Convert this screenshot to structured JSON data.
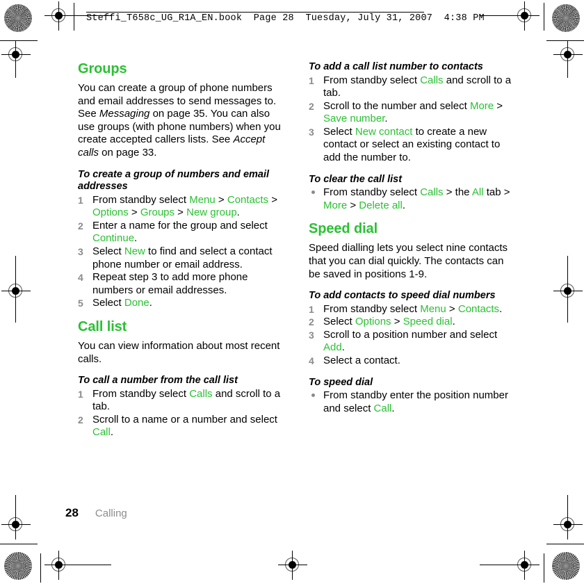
{
  "header": {
    "slug": "Steffi_T658c_UG_R1A_EN.book  Page 28  Tuesday, July 31, 2007  4:38 PM"
  },
  "footer": {
    "page_number": "28",
    "chapter": "Calling"
  },
  "colors": {
    "accent_green": "#2bc034",
    "step_number_gray": "#8a8a8a",
    "chapter_gray": "#8c8c8c",
    "body_black": "#000000"
  },
  "left_column": {
    "section_title": "Groups",
    "intro_a": "You can create a group of phone numbers and email addresses to send messages to. See ",
    "intro_a_em": "Messaging",
    "intro_b": " on page 35. You can also use groups (with phone numbers) when you create accepted callers lists. See ",
    "intro_b_em": "Accept calls",
    "intro_c": " on page 33.",
    "task1_title": "To create a group of numbers and email addresses",
    "task1_steps": [
      {
        "num": "1",
        "text": "From standby select Menu > Contacts > Options > Groups > New group."
      },
      {
        "num": "2",
        "text": "Enter a name for the group and select Continue."
      },
      {
        "num": "3",
        "text": "Select New to find and select a contact phone number or email address."
      },
      {
        "num": "4",
        "text": "Repeat step 3 to add more phone numbers or email addresses."
      },
      {
        "num": "5",
        "text": "Select Done."
      }
    ],
    "section2_title": "Call list",
    "section2_intro": "You can view information about most recent calls.",
    "task2_title": "To call a number from the call list",
    "task2_steps": [
      {
        "num": "1",
        "text": "From standby select Calls and scroll to a tab."
      },
      {
        "num": "2",
        "text": "Scroll to a name or a number and select Call."
      }
    ]
  },
  "right_column": {
    "task3_title": "To add a call list number to contacts",
    "task3_steps": [
      {
        "num": "1",
        "text": "From standby select Calls and scroll to a tab."
      },
      {
        "num": "2",
        "text": "Scroll to the number and select More > Save number."
      },
      {
        "num": "3",
        "text": "Select New contact to create a new contact or select an existing contact to add the number to."
      }
    ],
    "task4_title": "To clear the call list",
    "task4_bullets": [
      {
        "text": "From standby select Calls > the All tab > More > Delete all."
      }
    ],
    "section3_title": "Speed dial",
    "section3_intro": "Speed dialling lets you select nine contacts that you can dial quickly. The contacts can be saved in positions 1-9.",
    "task5_title": "To add contacts to speed dial numbers",
    "task5_steps": [
      {
        "num": "1",
        "text": "From standby select Menu > Contacts."
      },
      {
        "num": "2",
        "text": "Select Options > Speed dial."
      },
      {
        "num": "3",
        "text": "Scroll to a position number and select Add."
      },
      {
        "num": "4",
        "text": "Select a contact."
      }
    ],
    "task6_title": "To speed dial",
    "task6_bullets": [
      {
        "text": "From standby enter the position number and select Call."
      }
    ]
  },
  "link_terms": [
    "Menu",
    "Contacts",
    "Options",
    "Groups",
    "New group",
    "Continue",
    "New",
    "Done",
    "Calls",
    "Call",
    "More",
    "Save number",
    "New contact",
    "All",
    "Delete all",
    "Speed dial",
    "Add"
  ],
  "print_marks": {
    "registration_mark_name": "registration-target",
    "burst_mark_name": "star-burst-calibration-mark",
    "count_registration": 6,
    "count_burst": 4
  }
}
